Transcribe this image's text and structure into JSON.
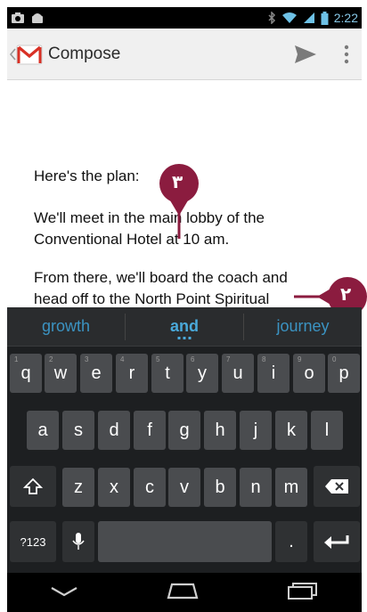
{
  "status_bar": {
    "time": "2:22"
  },
  "action_bar": {
    "title": "Compose"
  },
  "compose": {
    "lines": [
      "Here's the plan:",
      "We'll meet in the main lobby of the",
      "Conventional Hotel at 10 am.",
      "From there, we'll board the coach and",
      "head off to the North Point Spiritual"
    ]
  },
  "callouts": {
    "one": "٣",
    "two": "٢"
  },
  "keyboard": {
    "suggestions": [
      "growth",
      "and",
      "journey"
    ],
    "row1": [
      "q",
      "w",
      "e",
      "r",
      "t",
      "y",
      "u",
      "i",
      "o",
      "p"
    ],
    "row1_hints": [
      "1",
      "2",
      "3",
      "4",
      "5",
      "6",
      "7",
      "8",
      "9",
      "0"
    ],
    "row2": [
      "a",
      "s",
      "d",
      "f",
      "g",
      "h",
      "j",
      "k",
      "l"
    ],
    "row3": [
      "z",
      "x",
      "c",
      "v",
      "b",
      "n",
      "m"
    ],
    "symbols_label": "?123",
    "period_label": "."
  },
  "colors": {
    "suggestion": "#3b93c2",
    "callout": "#8b1c3f",
    "key": "#4a4c4f"
  },
  "icons": [
    "gmail-icon",
    "send-icon",
    "overflow-menu-icon",
    "shift-icon",
    "backspace-icon",
    "microphone-icon",
    "enter-icon",
    "back-nav-icon",
    "home-nav-icon",
    "recents-nav-icon"
  ]
}
